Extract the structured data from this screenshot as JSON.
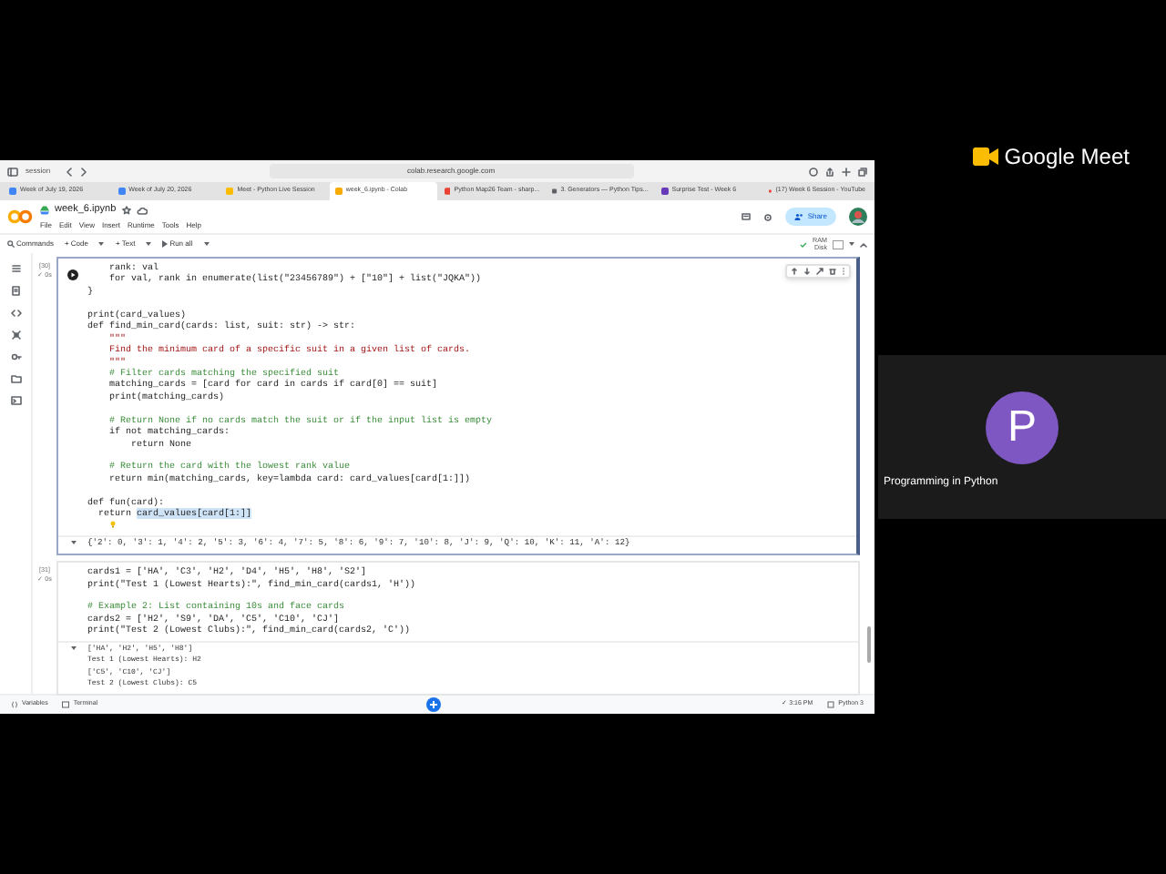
{
  "browser": {
    "sidebar_label": "session",
    "url": "colab.research.google.com",
    "tabs": [
      {
        "title": "Week of July 19, 2026",
        "selected": false
      },
      {
        "title": "Week of July 20, 2026",
        "selected": false
      },
      {
        "title": "Meet - Python Live Session",
        "selected": false
      },
      {
        "title": "week_6.ipynb - Colab",
        "selected": true
      },
      {
        "title": "Python Map26 Team - sharp...",
        "selected": false
      },
      {
        "title": "3. Generators — Python Tips...",
        "selected": false
      },
      {
        "title": "Surprise Test - Week 6",
        "selected": false
      },
      {
        "title": "(17) Week 6 Session - YouTube",
        "selected": false
      }
    ]
  },
  "notebook": {
    "filename": "week_6.ipynb",
    "menu": [
      "File",
      "Edit",
      "View",
      "Insert",
      "Runtime",
      "Tools",
      "Help"
    ],
    "share": "Share",
    "toolbar": [
      "Commands",
      "+ Code",
      "+ Text",
      "Run all"
    ],
    "ram_label": "RAM",
    "disk_label": "Disk"
  },
  "cells": [
    {
      "execution_count": "[30]",
      "run_time": "✓ 0s",
      "selected": true,
      "lines": [
        {
          "kind": "code",
          "text": "    rank: val"
        },
        {
          "kind": "code",
          "text": "    for val, rank in enumerate(list(\"23456789\") + [\"10\"] + list(\"JQKA\"))"
        },
        {
          "kind": "code",
          "text": "}"
        },
        {
          "kind": "blank"
        },
        {
          "kind": "code",
          "text": "print(card_values)"
        },
        {
          "kind": "code",
          "text": "def find_min_card(cards: list, suit: str) -> str:"
        },
        {
          "kind": "docstring",
          "text": "    \"\"\""
        },
        {
          "kind": "docstring",
          "text": "    Find the minimum card of a specific suit in a given list of cards."
        },
        {
          "kind": "docstring",
          "text": "    \"\"\""
        },
        {
          "kind": "comment",
          "text": "    # Filter cards matching the specified suit"
        },
        {
          "kind": "code",
          "text": "    matching_cards = [card for card in cards if card[0] == suit]"
        },
        {
          "kind": "code",
          "text": "    print(matching_cards)"
        },
        {
          "kind": "blank"
        },
        {
          "kind": "comment",
          "text": "    # Return None if no cards match the suit or if the input list is empty"
        },
        {
          "kind": "code",
          "text": "    if not matching_cards:"
        },
        {
          "kind": "code",
          "text": "        return None"
        },
        {
          "kind": "blank"
        },
        {
          "kind": "comment",
          "text": "    # Return the card with the lowest rank value"
        },
        {
          "kind": "code",
          "text": "    return min(matching_cards, key=lambda card: card_values[card[1:]])"
        },
        {
          "kind": "blank"
        },
        {
          "kind": "code",
          "text": "def fun(card):"
        },
        {
          "kind": "code",
          "text": "  return ",
          "selection": "card_values[card[1:]]"
        },
        {
          "kind": "hint"
        }
      ],
      "output": [
        "{'2': 0, '3': 1, '4': 2, '5': 3, '6': 4, '7': 5, '8': 6, '9': 7, '10': 8, 'J': 9, 'Q': 10, 'K': 11, 'A': 12}"
      ]
    },
    {
      "execution_count": "[31]",
      "run_time": "✓ 0s",
      "selected": false,
      "lines": [
        {
          "kind": "code",
          "text": "cards1 = ['HA', 'C3', 'H2', 'D4', 'H5', 'H8', 'S2']"
        },
        {
          "kind": "code",
          "text": "print(\"Test 1 (Lowest Hearts):\", find_min_card(cards1, 'H'))"
        },
        {
          "kind": "blank"
        },
        {
          "kind": "comment",
          "text": "# Example 2: List containing 10s and face cards"
        },
        {
          "kind": "code",
          "text": "cards2 = ['H2', 'S9', 'DA', 'C5', 'C10', 'CJ']"
        },
        {
          "kind": "code",
          "text": "print(\"Test 2 (Lowest Clubs):\", find_min_card(cards2, 'C'))"
        }
      ],
      "output": [
        "['HA', 'H2', 'H5', 'H8']",
        "Test 1 (Lowest Hearts): H2",
        "['C5', 'C10', 'CJ']",
        "Test 2 (Lowest Clubs): C5"
      ]
    }
  ],
  "status_bar": {
    "variables": "Variables",
    "terminal": "Terminal",
    "time": "✓ 3:16 PM",
    "runtime": "Python 3"
  },
  "meet": {
    "logo_text": "Google Meet",
    "participant": {
      "initial": "P",
      "name": "Programming in Python"
    }
  }
}
